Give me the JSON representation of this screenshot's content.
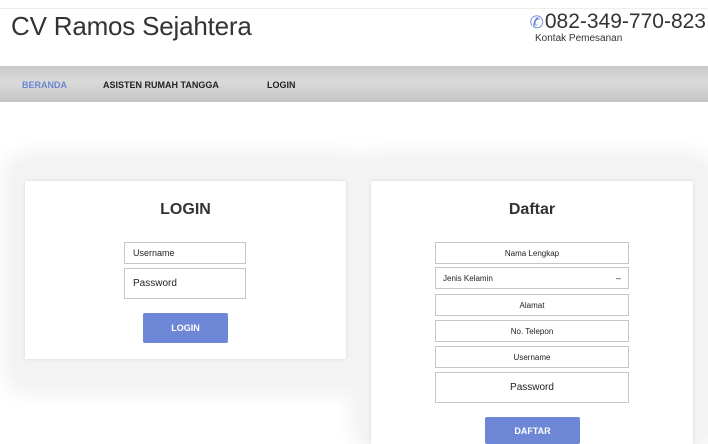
{
  "header": {
    "brand": "CV Ramos Sejahtera",
    "phone": "082-349-770-823",
    "phone_caption": "Kontak Pemesanan"
  },
  "nav": {
    "items": [
      {
        "label": "BERANDA",
        "active": true
      },
      {
        "label": "ASISTEN RUMAH TANGGA",
        "active": false
      },
      {
        "label": "LOGIN",
        "active": false
      }
    ]
  },
  "login": {
    "title": "LOGIN",
    "username_placeholder": "Username",
    "password_placeholder": "Password",
    "button": "LOGIN"
  },
  "register": {
    "title": "Daftar",
    "fullname_placeholder": "Nama Lengkap",
    "gender_selected": "Jenis Kelamin",
    "address_placeholder": "Alamat",
    "phone_placeholder": "No. Telepon",
    "username_placeholder": "Username",
    "password_placeholder": "Password",
    "button": "DAFTAR"
  },
  "colors": {
    "accent": "#6d87d6",
    "nav_active": "#6c86d3"
  },
  "icons": {
    "phone": "phone-icon",
    "dropdown": "chevron-down-icon"
  }
}
